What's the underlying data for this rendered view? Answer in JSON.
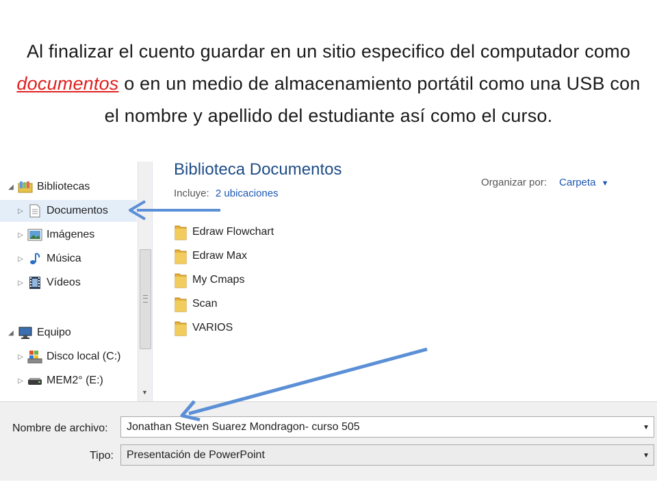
{
  "caption": {
    "before": "Al finalizar el cuento guardar en un sitio especifico del computador como ",
    "highlight": "documentos",
    "after": "  o en un medio de almacenamiento portátil como una USB con el nombre y apellido del estudiante así como el curso."
  },
  "nav": {
    "items": [
      {
        "label": "Bibliotecas",
        "icon": "libraries-icon"
      },
      {
        "label": "Documentos",
        "icon": "document-icon"
      },
      {
        "label": "Imágenes",
        "icon": "pictures-icon"
      },
      {
        "label": "Música",
        "icon": "music-icon"
      },
      {
        "label": "Vídeos",
        "icon": "videos-icon"
      },
      {
        "label": "Equipo",
        "icon": "computer-icon"
      },
      {
        "label": "Disco local (C:)",
        "icon": "local-disk-icon"
      },
      {
        "label": "MEM2° (E:)",
        "icon": "usb-drive-icon"
      }
    ]
  },
  "library": {
    "title": "Biblioteca Documentos",
    "includes_label": "Incluye:",
    "includes_link": "2 ubicaciones",
    "arrange_label": "Organizar por:",
    "arrange_value": "Carpeta"
  },
  "folders": [
    "Edraw Flowchart",
    "Edraw Max",
    "My Cmaps",
    "Scan",
    "VARIOS"
  ],
  "save": {
    "filename_label": "Nombre de archivo:",
    "filename_value": "Jonathan Steven Suarez Mondragon- curso 505",
    "type_label": "Tipo:",
    "type_value": "Presentación de PowerPoint"
  },
  "colors": {
    "highlight": "#e02020",
    "link": "#1a56b5",
    "title": "#1e4c86",
    "arrow": "#5b8fd6",
    "folder": "#e3b13c"
  }
}
